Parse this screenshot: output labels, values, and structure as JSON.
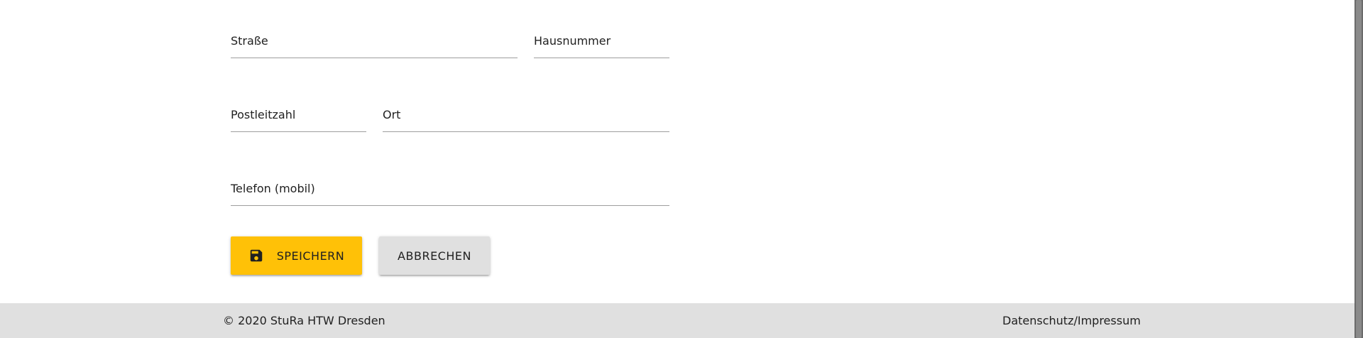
{
  "form": {
    "street_label": "Straße",
    "house_number_label": "Hausnummer",
    "postal_code_label": "Postleitzahl",
    "city_label": "Ort",
    "phone_label": "Telefon (mobil)"
  },
  "actions": {
    "save_label": "SPEICHERN",
    "cancel_label": "ABBRECHEN",
    "save_icon": "floppy-disk-icon"
  },
  "footer": {
    "copyright": "© 2020 StuRa HTW Dresden",
    "privacy_link": "Datenschutz/Impressum"
  },
  "colors": {
    "primary": "#ffc107",
    "secondary_button": "#e0e0e0",
    "footer_bg": "#e0e0e0"
  }
}
